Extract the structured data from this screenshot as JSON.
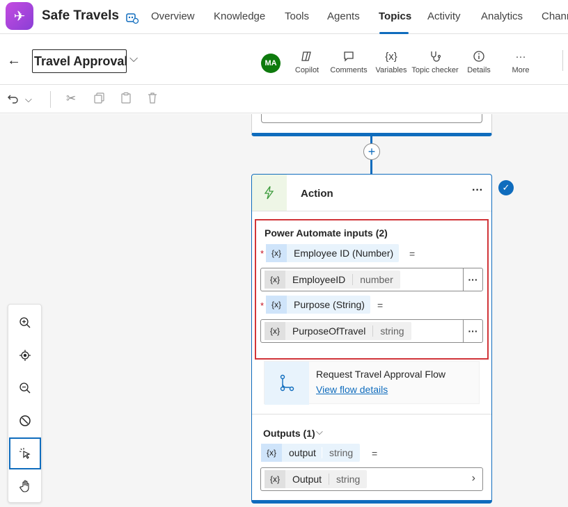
{
  "app": {
    "name": "Safe Travels",
    "logo_icon": "airplane-icon",
    "bot_icon": "bot-settings-icon"
  },
  "nav": {
    "tabs": [
      "Overview",
      "Knowledge",
      "Tools",
      "Agents",
      "Topics",
      "Activity",
      "Analytics",
      "Chann"
    ],
    "active": "Topics"
  },
  "topic": {
    "name": "Travel Approval",
    "avatar_initials": "MA",
    "tools": [
      {
        "label": "Copilot",
        "icon": "copilot-icon"
      },
      {
        "label": "Comments",
        "icon": "comment-icon"
      },
      {
        "label": "Variables",
        "icon": "variable-icon",
        "glyph": "{x}"
      },
      {
        "label": "Topic checker",
        "icon": "stethoscope-icon"
      },
      {
        "label": "Details",
        "icon": "info-icon"
      },
      {
        "label": "More",
        "icon": "more-icon",
        "glyph": "···"
      }
    ]
  },
  "edit_toolbar": {
    "icons": [
      "undo-icon",
      "chevron-down-icon",
      "cut-icon",
      "copy-icon",
      "paste-icon",
      "delete-icon"
    ]
  },
  "action_node": {
    "title": "Action",
    "more": "···",
    "inputs_title": "Power Automate inputs (2)",
    "inputs": [
      {
        "label": "Employee ID (Number)",
        "var_glyph": "{x}",
        "value_name": "EmployeeID",
        "value_type": "number"
      },
      {
        "label": "Purpose (String)",
        "var_glyph": "{x}",
        "value_name": "PurposeOfTravel",
        "value_type": "string"
      }
    ],
    "flow_name": "Request Travel Approval Flow",
    "flow_link": "View flow details",
    "outputs_title": "Outputs (1)",
    "output_var": {
      "name": "output",
      "type": "string"
    },
    "output_value": {
      "name": "Output",
      "type": "string"
    }
  },
  "zoom_panel": {
    "buttons": [
      "zoom-in-icon",
      "recenter-icon",
      "zoom-out-icon",
      "reset-icon",
      "select-pointer-icon",
      "pan-hand-icon"
    ],
    "selected": "select-pointer-icon"
  },
  "colors": {
    "accent": "#0f6cbd",
    "highlight_border": "#d13438",
    "avatar": "#0e7a0d"
  }
}
